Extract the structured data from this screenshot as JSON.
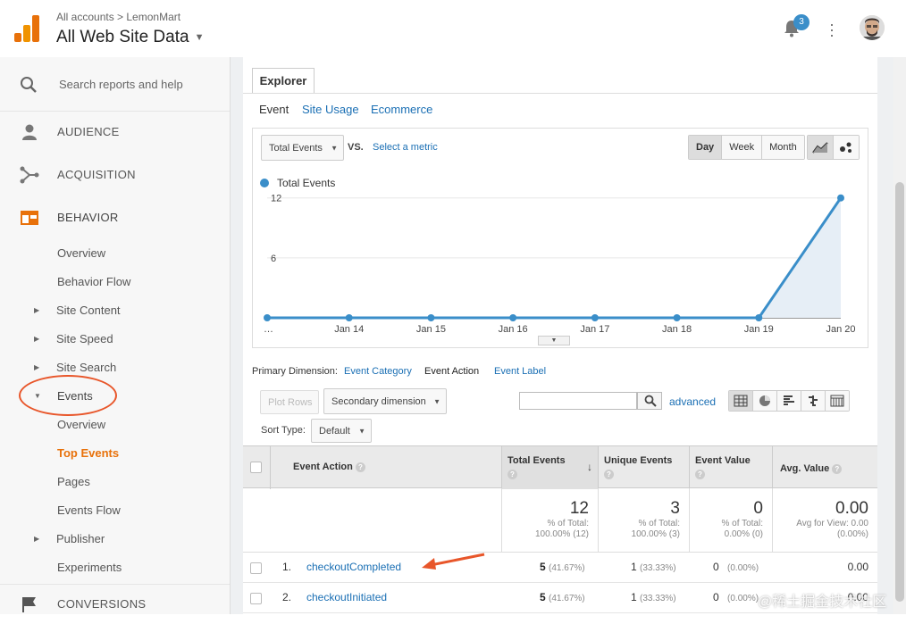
{
  "header": {
    "breadcrumb": "All accounts > LemonMart",
    "view_name": "All Web Site Data",
    "notification_count": "3",
    "icons": [
      "analytics-logo-icon",
      "bell-icon",
      "more-vert-icon",
      "avatar"
    ]
  },
  "sidebar": {
    "search_label": "Search reports and help",
    "sections": [
      {
        "label": "AUDIENCE",
        "icon": "person-icon"
      },
      {
        "label": "ACQUISITION",
        "icon": "acquisition-icon"
      },
      {
        "label": "BEHAVIOR",
        "icon": "behavior-icon"
      }
    ],
    "behavior_items": [
      {
        "label": "Overview",
        "expandable": false
      },
      {
        "label": "Behavior Flow",
        "expandable": false
      },
      {
        "label": "Site Content",
        "expandable": true
      },
      {
        "label": "Site Speed",
        "expandable": true
      },
      {
        "label": "Site Search",
        "expandable": true
      },
      {
        "label": "Events",
        "expandable": true,
        "expanded": true
      }
    ],
    "events_items": [
      {
        "label": "Overview"
      },
      {
        "label": "Top Events",
        "current": true
      },
      {
        "label": "Pages"
      },
      {
        "label": "Events Flow"
      }
    ],
    "after_items": [
      {
        "label": "Publisher",
        "expandable": true
      },
      {
        "label": "Experiments",
        "expandable": false
      }
    ],
    "conversions_label": "CONVERSIONS",
    "accent_color": "#e8710a"
  },
  "explorer": {
    "tab_label": "Explorer",
    "subtabs": [
      "Event",
      "Site Usage",
      "Ecommerce"
    ],
    "metric_select": "Total Events",
    "vs_label": "VS.",
    "select_metric_link": "Select a metric",
    "granularity": [
      "Day",
      "Week",
      "Month"
    ],
    "granularity_selected": "Day",
    "legend_label": "Total Events"
  },
  "chart_data": {
    "type": "line",
    "x": [
      "…",
      "Jan 14",
      "Jan 15",
      "Jan 16",
      "Jan 17",
      "Jan 18",
      "Jan 19",
      "Jan 20"
    ],
    "series": [
      {
        "name": "Total Events",
        "values": [
          0,
          0,
          0,
          0,
          0,
          0,
          0,
          12
        ]
      }
    ],
    "y_ticks": [
      12,
      6
    ],
    "ylim": [
      0,
      12.6
    ],
    "color": "#3a8ec9",
    "fill": true,
    "grid": "horizontal"
  },
  "dimensions": {
    "label": "Primary Dimension:",
    "items": [
      "Event Category",
      "Event Action",
      "Event Label"
    ],
    "selected": "Event Action"
  },
  "controls": {
    "plot_rows": "Plot Rows",
    "secondary_dimension": "Secondary dimension",
    "search_value": "",
    "advanced": "advanced",
    "sort_type_label": "Sort Type:",
    "sort_type_value": "Default",
    "view_icons": [
      "table-view-icon",
      "pie-view-icon",
      "performance-view-icon",
      "comparison-view-icon",
      "pivot-view-icon"
    ]
  },
  "table": {
    "columns": [
      "Event Action",
      "Total Events",
      "Unique Events",
      "Event Value",
      "Avg. Value"
    ],
    "totals": {
      "total_events": "12",
      "total_events_sub": "% of Total:\n100.00% (12)",
      "unique_events": "3",
      "unique_events_sub": "% of Total:\n100.00% (3)",
      "event_value": "0",
      "event_value_sub": "% of Total:\n0.00% (0)",
      "avg_value": "0.00",
      "avg_value_sub": "Avg for View: 0.00\n(0.00%)"
    },
    "rows": [
      {
        "idx": "1.",
        "action": "checkoutCompleted",
        "total": "5",
        "total_pct": "(41.67%)",
        "unique": "1",
        "unique_pct": "(33.33%)",
        "value": "0",
        "value_pct": "(0.00%)",
        "avg": "0.00"
      },
      {
        "idx": "2.",
        "action": "checkoutInitiated",
        "total": "5",
        "total_pct": "(41.67%)",
        "unique": "1",
        "unique_pct": "(33.33%)",
        "value": "0",
        "value_pct": "(0.00%)",
        "avg": "0.00"
      }
    ]
  },
  "watermark": "@稀土掘金技术社区"
}
